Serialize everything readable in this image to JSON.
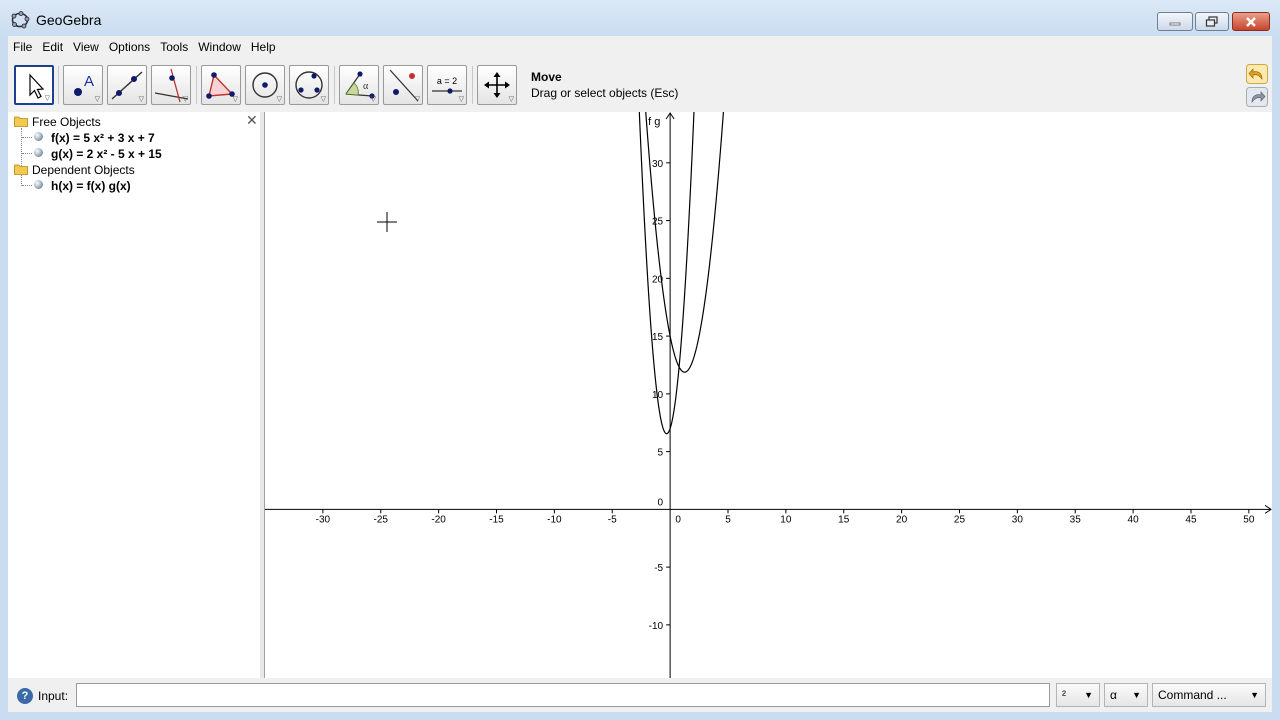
{
  "window": {
    "title": "GeoGebra"
  },
  "menu": [
    "File",
    "Edit",
    "View",
    "Options",
    "Tools",
    "Window",
    "Help"
  ],
  "toolbar": {
    "tools": [
      "move-tool",
      "point-tool",
      "line-tool",
      "perpendicular-line-tool",
      "polygon-tool",
      "circle-tool",
      "conic-tool",
      "angle-tool",
      "reflect-tool",
      "slider-tool",
      "move-graphics-view-tool"
    ],
    "slider_label": "a = 2",
    "active_tool_name": "Move",
    "active_tool_help": "Drag or select objects (Esc)"
  },
  "algebra": {
    "free_objects_label": "Free Objects",
    "dependent_objects_label": "Dependent Objects",
    "free_objects": [
      "f(x) = 5 x² + 3 x + 7",
      "g(x) = 2 x² - 5 x + 15"
    ],
    "dependent_objects": [
      "h(x) = f(x) g(x)"
    ]
  },
  "graphics": {
    "function_labels": "f g",
    "x_ticks": [
      "-30",
      "-25",
      "-20",
      "-15",
      "-10",
      "-5",
      "0",
      "5",
      "10",
      "15",
      "20",
      "25",
      "30",
      "35",
      "40",
      "45",
      "50"
    ],
    "y_ticks": [
      "30",
      "25",
      "20",
      "15",
      "10",
      "5",
      "0",
      "-5",
      "-10"
    ],
    "x_range": [
      -35,
      52
    ],
    "y_range": [
      -14.6,
      34.4
    ],
    "functions": [
      {
        "name": "f",
        "a": 5,
        "b": 3,
        "c": 7
      },
      {
        "name": "g",
        "a": 2,
        "b": -5,
        "c": 15
      }
    ]
  },
  "input_bar": {
    "label": "Input:",
    "value": "",
    "superscript_combo": "²",
    "greek_combo": "α",
    "command_combo": "Command ..."
  }
}
